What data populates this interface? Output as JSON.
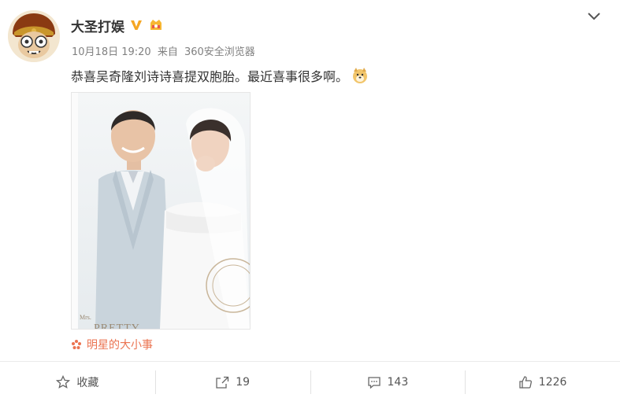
{
  "post": {
    "author": "大圣打娱",
    "time": "10月18日 19:20",
    "source_prefix": "来自",
    "source": "360安全浏览器",
    "text": "恭喜吴奇隆刘诗诗喜提双胞胎。最近喜事很多啊。",
    "photo_texts": {
      "mrs": "Mrs.",
      "pretty": "PRETTY"
    },
    "topic": "明星的大小事"
  },
  "actions": {
    "favorite_label": "收藏",
    "repost_count": "19",
    "comment_count": "143",
    "like_count": "1226"
  },
  "colors": {
    "topic": "#eb7350",
    "verified": "#f5a623",
    "meta": "#808080"
  }
}
